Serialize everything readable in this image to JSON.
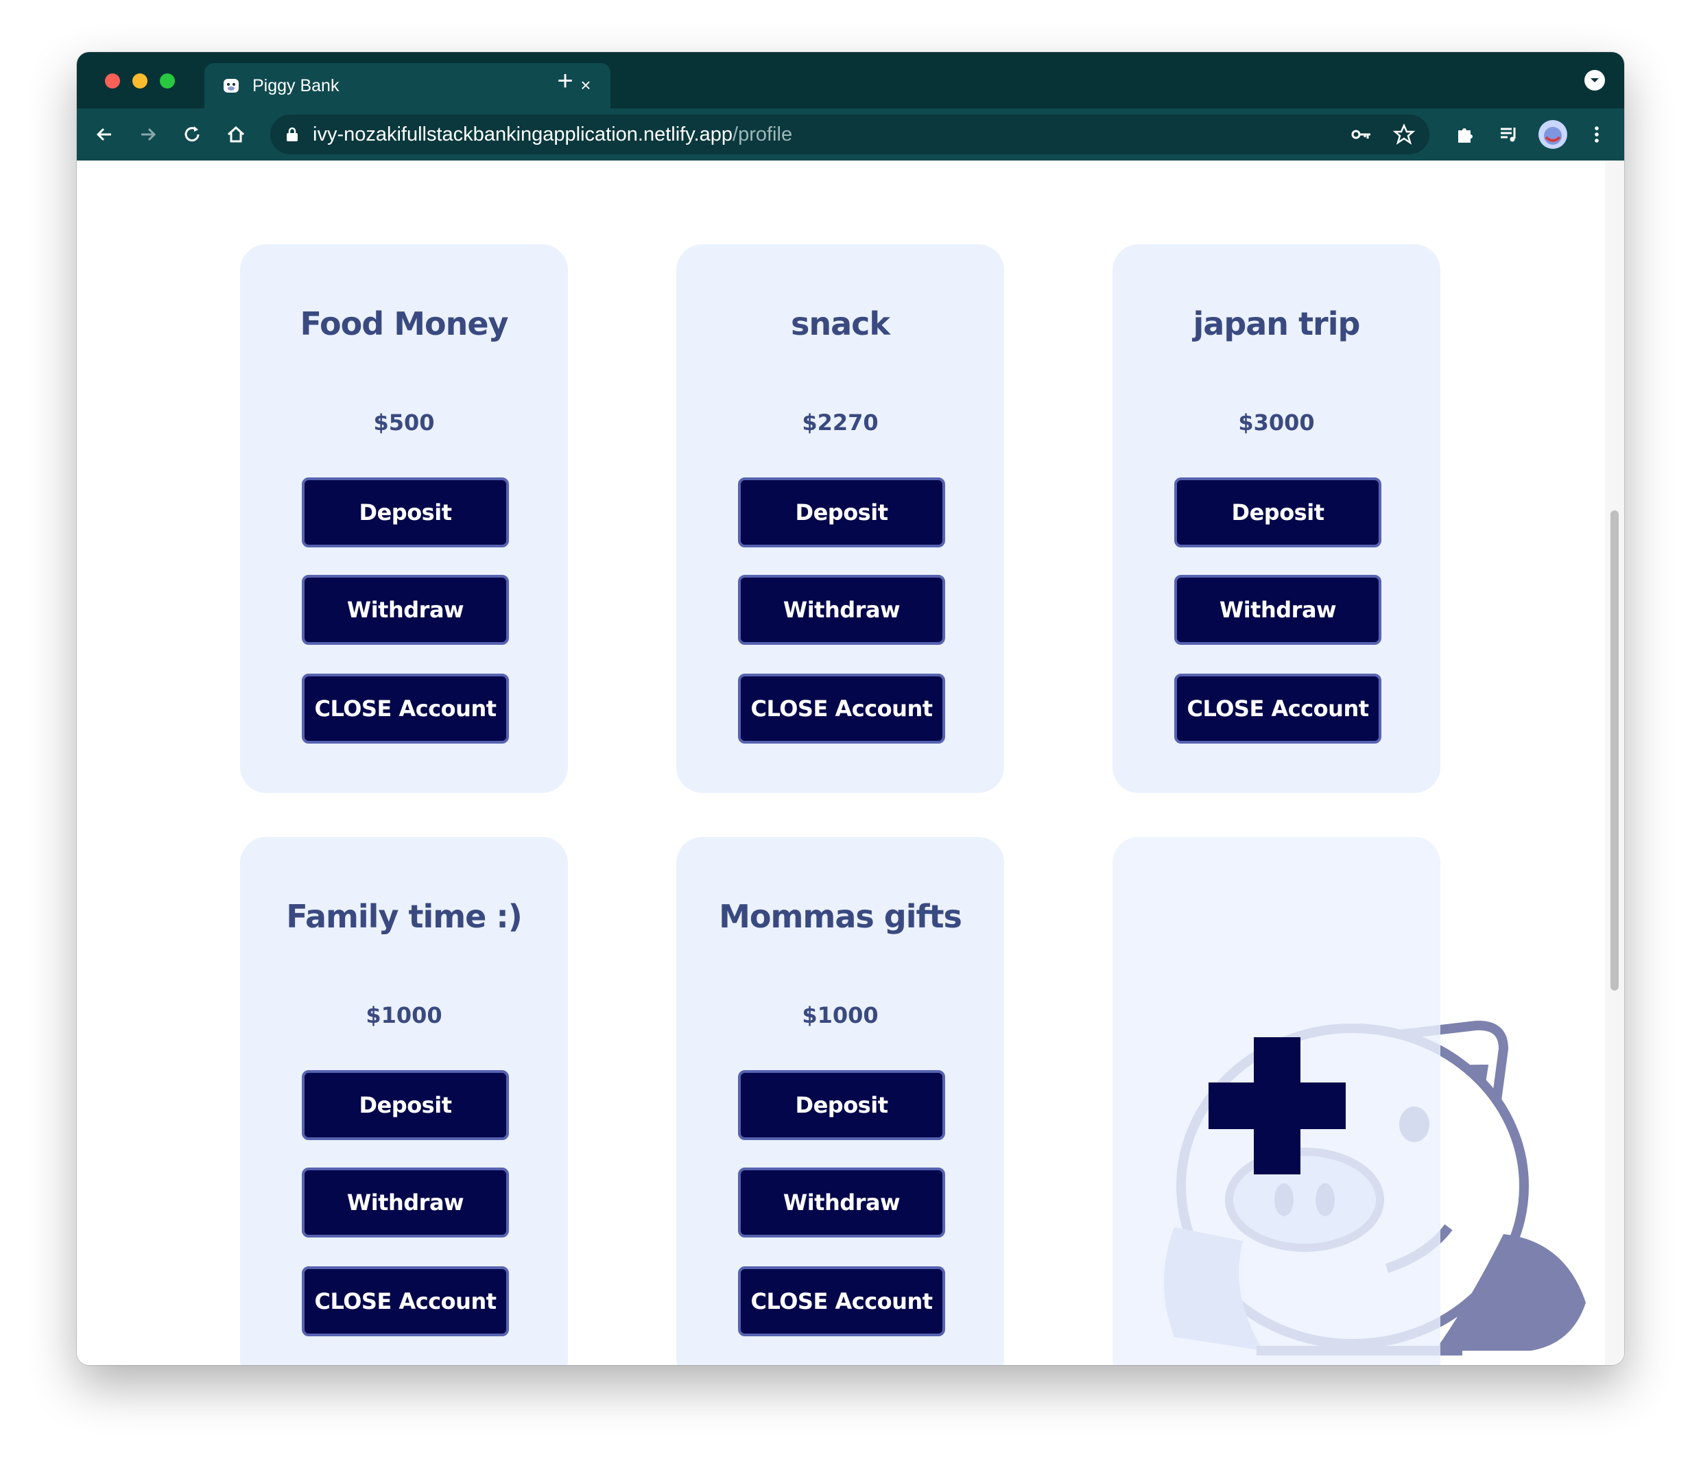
{
  "browser": {
    "tab_title": "Piggy Bank",
    "tab_close": "×",
    "new_tab": "+",
    "url_host": "ivy-nozakifullstackbankingapplication.netlify.app",
    "url_path": "/profile"
  },
  "accounts": [
    {
      "name": "Food Money",
      "balance": "$500",
      "deposit_label": "Deposit",
      "withdraw_label": "Withdraw",
      "close_label": "CLOSE Account"
    },
    {
      "name": "snack",
      "balance": "$2270",
      "deposit_label": "Deposit",
      "withdraw_label": "Withdraw",
      "close_label": "CLOSE Account"
    },
    {
      "name": "japan trip",
      "balance": "$3000",
      "deposit_label": "Deposit",
      "withdraw_label": "Withdraw",
      "close_label": "CLOSE Account"
    },
    {
      "name": "Family time :)",
      "balance": "$1000",
      "deposit_label": "Deposit",
      "withdraw_label": "Withdraw",
      "close_label": "CLOSE Account"
    },
    {
      "name": "Mommas gifts",
      "balance": "$1000",
      "deposit_label": "Deposit",
      "withdraw_label": "Withdraw",
      "close_label": "CLOSE Account"
    }
  ],
  "add_account": {
    "icon": "plus-icon"
  },
  "colors": {
    "chrome_dark": "#083336",
    "chrome_toolbar": "#0f4a4f",
    "card_bg": "#ebf2fe",
    "button_bg": "#03064a",
    "button_border": "#5763b0",
    "text_heading": "#3a4a80"
  }
}
